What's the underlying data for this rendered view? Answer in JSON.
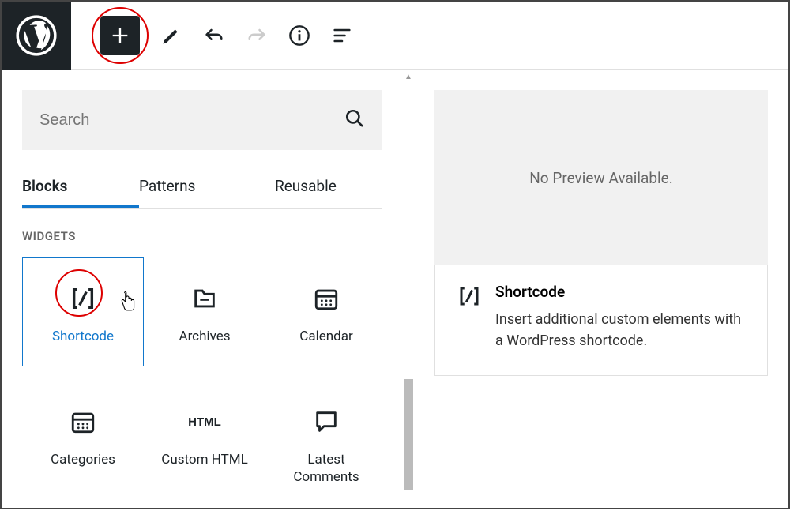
{
  "search": {
    "placeholder": "Search"
  },
  "tabs": {
    "blocks": "Blocks",
    "patterns": "Patterns",
    "reusable": "Reusable"
  },
  "section": {
    "widgets": "WIDGETS"
  },
  "blocks": {
    "shortcode": "Shortcode",
    "archives": "Archives",
    "calendar": "Calendar",
    "categories": "Categories",
    "custom_html": "Custom HTML",
    "custom_html_icon": "HTML",
    "latest_comments": "Latest\nComments"
  },
  "preview": {
    "empty": "No Preview Available."
  },
  "detail": {
    "title": "Shortcode",
    "desc": "Insert additional custom elements with a WordPress shortcode."
  }
}
